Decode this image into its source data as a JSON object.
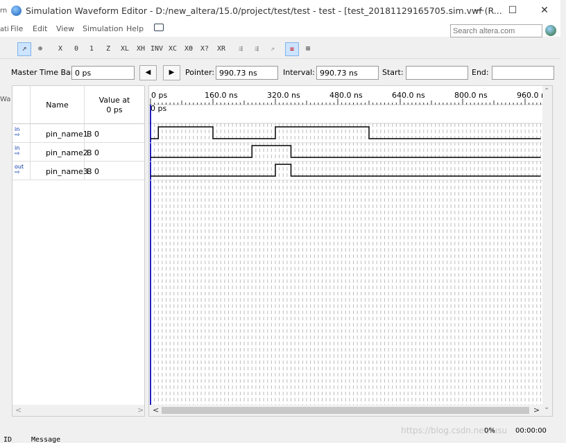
{
  "window": {
    "title": "Simulation Waveform Editor - D:/new_altera/15.0/project/test/test - test - [test_20181129165705.sim.vwf (R...",
    "minimize_glyph": "—",
    "maximize_glyph": "☐",
    "close_glyph": "✕"
  },
  "menu": {
    "items": [
      "File",
      "Edit",
      "View",
      "Simulation",
      "Help"
    ]
  },
  "search": {
    "placeholder": "Search altera.com"
  },
  "toolbar": {
    "icons": [
      "selection-tool-icon",
      "zoom-tool-icon",
      "force-unknown-icon",
      "force-low-icon",
      "force-high-icon",
      "force-high-impedance-icon",
      "force-weak-low-icon",
      "force-weak-high-icon",
      "invert-icon",
      "count-value-icon",
      "clock-value-icon",
      "arbitrary-value-icon",
      "random-value-icon",
      "overwrite-icon",
      "run-functional-icon",
      "run-timing-icon",
      "waveform-view-icon",
      "grid-icon",
      "snap-icon"
    ]
  },
  "timebar": {
    "master_label": "Master Time Bar:",
    "master_value": "0 ps",
    "prev_glyph": "◀",
    "next_glyph": "▶",
    "pointer_label": "Pointer:",
    "pointer_value": "990.73 ns",
    "interval_label": "Interval:",
    "interval_value": "990.73 ns",
    "start_label": "Start:",
    "start_value": "",
    "end_label": "End:",
    "end_value": ""
  },
  "grid_header": {
    "name": "Name",
    "value_at": "Value at",
    "value_time": "0 ps"
  },
  "signals": [
    {
      "icon": "in",
      "name": "pin_name1",
      "value": "B 0",
      "waveform": [
        [
          0,
          0
        ],
        [
          20,
          1
        ],
        [
          160,
          0
        ],
        [
          320,
          1
        ],
        [
          560,
          0
        ],
        [
          1000,
          0
        ]
      ]
    },
    {
      "icon": "in",
      "name": "pin_name2",
      "value": "B 0",
      "waveform": [
        [
          0,
          0
        ],
        [
          260,
          1
        ],
        [
          360,
          0
        ],
        [
          1000,
          0
        ]
      ]
    },
    {
      "icon": "out",
      "name": "pin_name3",
      "value": "B 0",
      "waveform": [
        [
          0,
          0
        ],
        [
          320,
          1
        ],
        [
          360,
          0
        ],
        [
          1000,
          0
        ]
      ]
    }
  ],
  "timeline": {
    "ticks": [
      "0 ps",
      "160.0 ns",
      "320.0 ns",
      "480.0 ns",
      "640.0 ns",
      "800.0 ns",
      "960.0 ns"
    ],
    "cursor_label": "0 ps",
    "range_ns": [
      0,
      1000
    ]
  },
  "status": {
    "progress": "0%",
    "elapsed": "00:00:00",
    "watermark": "https://blog.csdn.net/lusu"
  },
  "background_text": {
    "left_fragments": [
      "rn",
      "ati",
      "Wa"
    ],
    "bottom_left": "ID",
    "bottom_message": "Message"
  }
}
